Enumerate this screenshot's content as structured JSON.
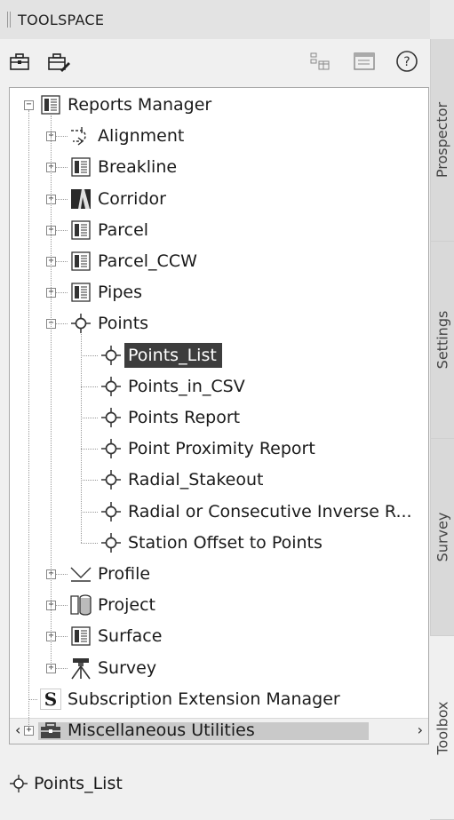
{
  "titlebar": {
    "title": "TOOLSPACE"
  },
  "toolbar": {
    "icons": [
      "toolbox-icon",
      "edit-toolbox-icon",
      "details-view-icon",
      "list-view-icon",
      "help-icon"
    ],
    "help_glyph": "?"
  },
  "tree": {
    "root": "Reports Manager",
    "categories": [
      "Alignment",
      "Breakline",
      "Corridor",
      "Parcel",
      "Parcel_CCW",
      "Pipes",
      "Points"
    ],
    "points_items": [
      "Points_List",
      "Points_in_CSV",
      "Points Report",
      "Point Proximity Report",
      "Radial_Stakeout",
      "Radial or Consecutive Inverse R...",
      "Station Offset to Points"
    ],
    "categories_after": [
      "Profile",
      "Project",
      "Surface",
      "Survey"
    ],
    "subscription": "Subscription Extension Manager",
    "subscription_glyph": "S",
    "misc": "Miscellaneous Utilities",
    "selected": "Points_List"
  },
  "scrollbar": {
    "left": "‹",
    "right": "›"
  },
  "status": {
    "label": "Points_List"
  },
  "tabs": [
    "Prospector",
    "Settings",
    "Survey",
    "Toolbox"
  ],
  "colors": {
    "selection": "#3d3d3d",
    "background": "#f0f0f0"
  }
}
